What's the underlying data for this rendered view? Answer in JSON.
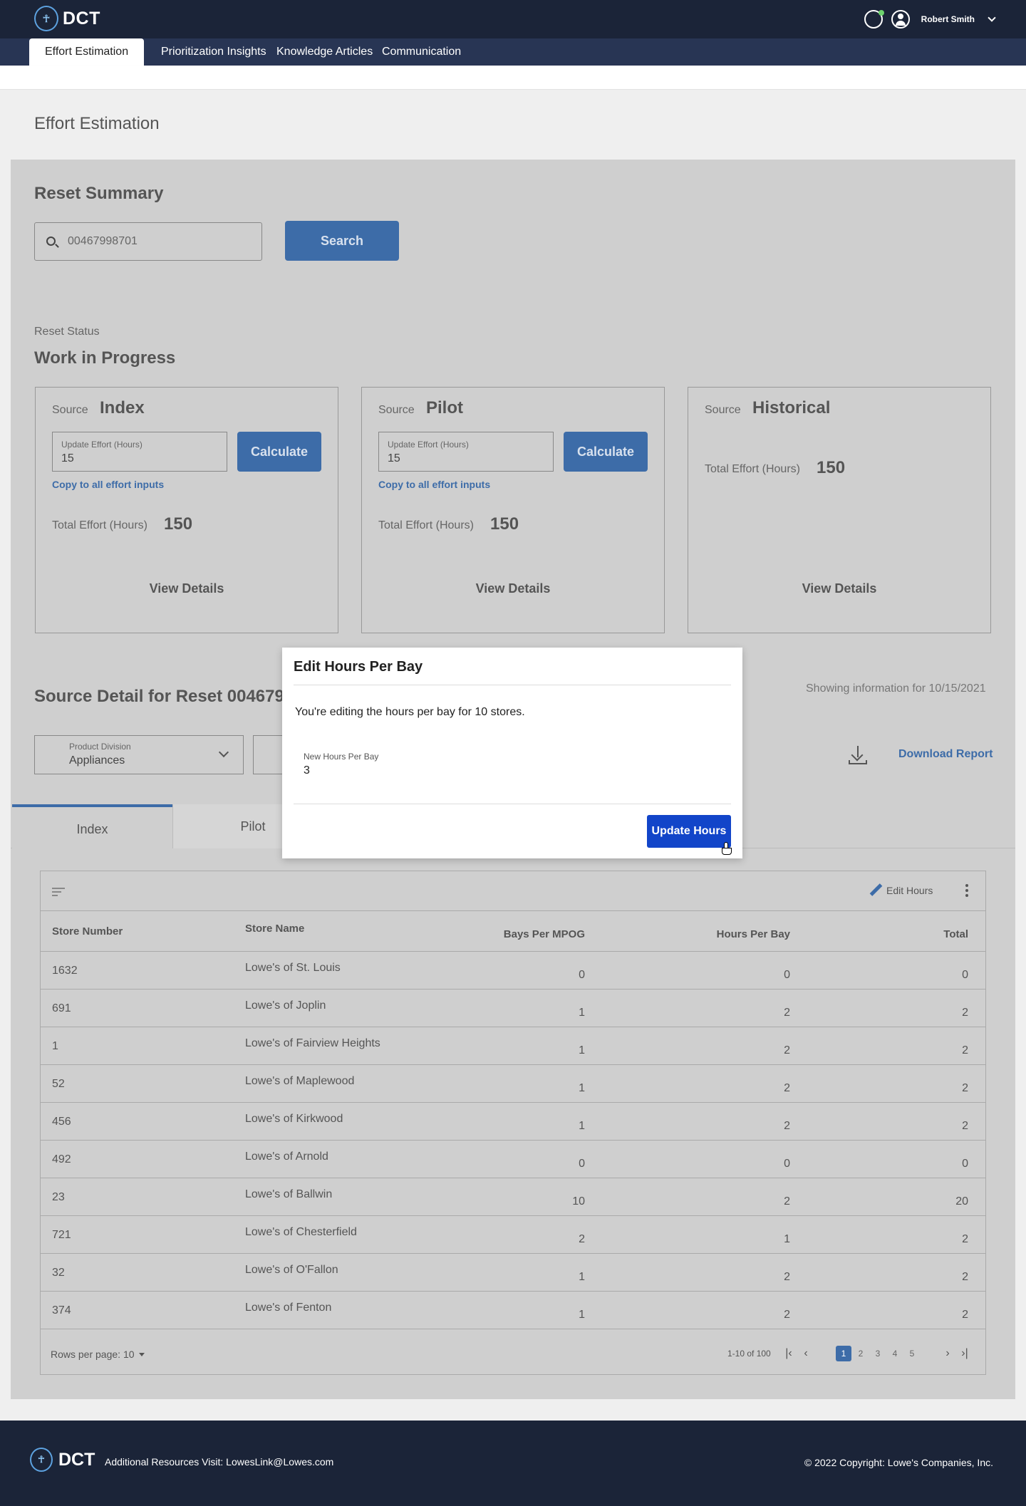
{
  "app": {
    "logo_text": "DCT",
    "logo_glyph": "☥",
    "user_name": "Robert Smith"
  },
  "nav": {
    "tabs": [
      "Effort Estimation",
      "Prioritization Insights",
      "Knowledge Articles",
      "Communication"
    ]
  },
  "page_title": "Effort Estimation",
  "reset_summary": {
    "title": "Reset Summary",
    "search_value": "00467998701",
    "search_label": "Search",
    "status_label": "Reset Status",
    "status_value": "Work in Progress"
  },
  "cards": [
    {
      "source_label": "Source",
      "source_name": "Index",
      "input_caption": "Update Effort (Hours)",
      "input_value": "15",
      "calculate_label": "Calculate",
      "copy_label": "Copy to all effort inputs",
      "total_label": "Total Effort (Hours)",
      "total_value": "150",
      "view_label": "View Details"
    },
    {
      "source_label": "Source",
      "source_name": "Pilot",
      "input_caption": "Update Effort (Hours)",
      "input_value": "15",
      "calculate_label": "Calculate",
      "copy_label": "Copy to all effort inputs",
      "total_label": "Total Effort (Hours)",
      "total_value": "150",
      "view_label": "View Details"
    },
    {
      "source_label": "Source",
      "source_name": "Historical",
      "total_label": "Total Effort (Hours)",
      "total_value": "150",
      "view_label": "View Details"
    }
  ],
  "source_detail": {
    "title": "Source Detail for Reset 0046799",
    "showing": "Showing information for 10/15/2021",
    "division_caption": "Product Division",
    "division_value": "Appliances",
    "download_label": "Download Report"
  },
  "detail_tabs": [
    "Index",
    "Pilot"
  ],
  "table": {
    "edit_label": "Edit Hours",
    "headers": [
      "Store Number",
      "Store Name",
      "Bays Per MPOG",
      "Hours Per Bay",
      "Total"
    ],
    "rows": [
      [
        "1632",
        "Lowe's of St. Louis",
        "0",
        "0",
        "0"
      ],
      [
        "691",
        "Lowe's of Joplin",
        "1",
        "2",
        "2"
      ],
      [
        "1",
        "Lowe's of Fairview Heights",
        "1",
        "2",
        "2"
      ],
      [
        "52",
        "Lowe's of Maplewood",
        "1",
        "2",
        "2"
      ],
      [
        "456",
        "Lowe's of Kirkwood",
        "1",
        "2",
        "2"
      ],
      [
        "492",
        "Lowe's of Arnold",
        "0",
        "0",
        "0"
      ],
      [
        "23",
        "Lowe's of Ballwin",
        "10",
        "2",
        "20"
      ],
      [
        "721",
        "Lowe's of Chesterfield",
        "2",
        "1",
        "2"
      ],
      [
        "32",
        "Lowe's of O'Fallon",
        "1",
        "2",
        "2"
      ],
      [
        "374",
        "Lowe's of Fenton",
        "1",
        "2",
        "2"
      ]
    ],
    "rows_per_page": "Rows per page: 10",
    "range": "1-10 of 100",
    "pages": [
      "1",
      "2",
      "3",
      "4",
      "5"
    ],
    "current_page": "1"
  },
  "modal": {
    "title": "Edit Hours Per Bay",
    "message": "You're editing the hours per bay for 10 stores.",
    "field_caption": "New Hours Per Bay",
    "field_value": "3",
    "button_label": "Update Hours"
  },
  "footer": {
    "logo_text": "DCT",
    "resources": "Additional Resources Visit: LowesLink@Lowes.com",
    "copyright": "© 2022 Copyright: Lowe's Companies, Inc."
  }
}
